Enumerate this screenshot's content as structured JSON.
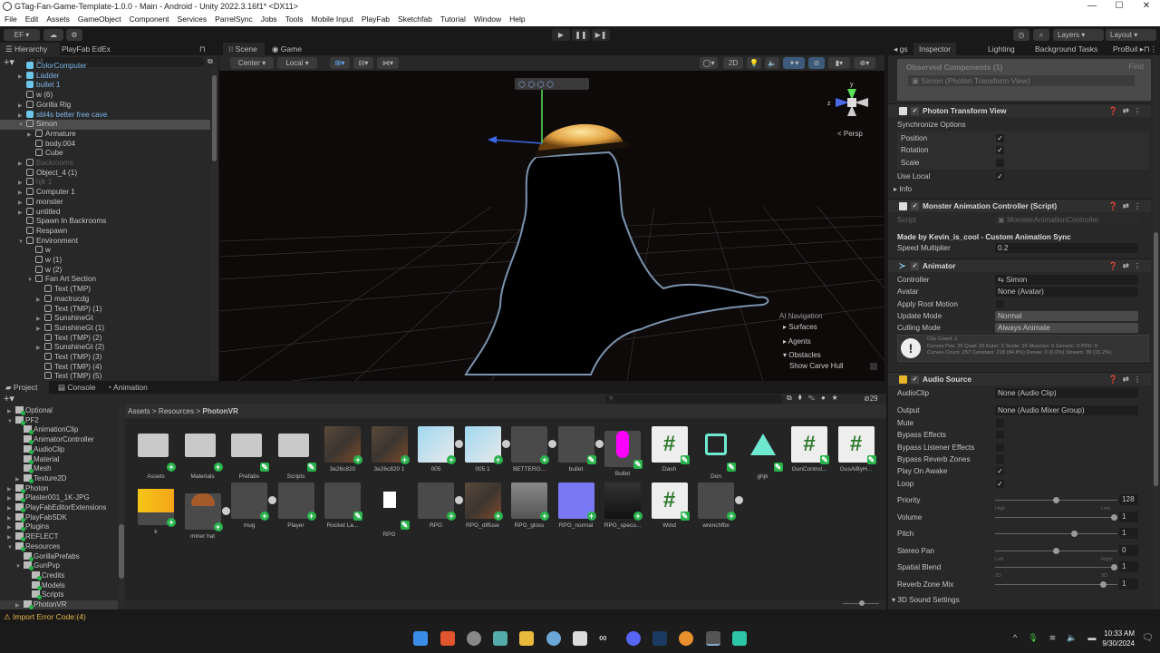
{
  "window": {
    "title": "GTag-Fan-Game-Template-1.0.0 - Main - Android - Unity 2022.3.16f1* <DX11>",
    "min": "—",
    "max": "☐",
    "close": "✕"
  },
  "menu": [
    "File",
    "Edit",
    "Assets",
    "GameObject",
    "Component",
    "Services",
    "ParrelSync",
    "Jobs",
    "Tools",
    "Mobile Input",
    "PlayFab",
    "Sketchfab",
    "Tutorial",
    "Window",
    "Help"
  ],
  "toolbar": {
    "account": "EF ▾",
    "layers": "Layers",
    "layout": "Layout"
  },
  "hierarchy": {
    "tabs": [
      "Hierarchy",
      "PlayFab EdEx"
    ],
    "search_placeholder": "All",
    "items": [
      {
        "label": "ColorComputer",
        "depth": 1,
        "arrow": "",
        "prefab": true,
        "dim": false
      },
      {
        "label": "Ladder",
        "depth": 1,
        "arrow": "▶",
        "prefab": true,
        "dim": false
      },
      {
        "label": "bullet 1",
        "depth": 1,
        "arrow": "",
        "prefab": true,
        "dim": false
      },
      {
        "label": "w (6)",
        "depth": 1,
        "arrow": "",
        "prefab": false,
        "dim": false
      },
      {
        "label": "Gorilla Rig",
        "depth": 1,
        "arrow": "▶",
        "prefab": false,
        "dim": false
      },
      {
        "label": "sbl4s better free cave",
        "depth": 1,
        "arrow": "▶",
        "prefab": true,
        "dim": false
      },
      {
        "label": "Simon",
        "depth": 1,
        "arrow": "▼",
        "prefab": false,
        "dim": false,
        "selected": true
      },
      {
        "label": "Armature",
        "depth": 2,
        "arrow": "▶",
        "prefab": false,
        "dim": false
      },
      {
        "label": "body.004",
        "depth": 2,
        "arrow": "",
        "prefab": false,
        "dim": false
      },
      {
        "label": "Cube",
        "depth": 2,
        "arrow": "",
        "prefab": false,
        "dim": false
      },
      {
        "label": "Backrooms",
        "depth": 1,
        "arrow": "▶",
        "prefab": false,
        "dim": true
      },
      {
        "label": "Object_4 (1)",
        "depth": 1,
        "arrow": "",
        "prefab": false,
        "dim": false
      },
      {
        "label": "hjk 1",
        "depth": 1,
        "arrow": "▶",
        "prefab": false,
        "dim": true
      },
      {
        "label": "Computer 1",
        "depth": 1,
        "arrow": "▶",
        "prefab": false,
        "dim": false
      },
      {
        "label": "monster",
        "depth": 1,
        "arrow": "▶",
        "prefab": false,
        "dim": false
      },
      {
        "label": "untitled",
        "depth": 1,
        "arrow": "▶",
        "prefab": false,
        "dim": false
      },
      {
        "label": "Spawn In Backrooms",
        "depth": 1,
        "arrow": "",
        "prefab": false,
        "dim": false
      },
      {
        "label": "Respawn",
        "depth": 1,
        "arrow": "",
        "prefab": false,
        "dim": false
      },
      {
        "label": "Environment",
        "depth": 1,
        "arrow": "▼",
        "prefab": false,
        "dim": false
      },
      {
        "label": "w",
        "depth": 2,
        "arrow": "",
        "prefab": false,
        "dim": false
      },
      {
        "label": "w (1)",
        "depth": 2,
        "arrow": "",
        "prefab": false,
        "dim": false
      },
      {
        "label": "w (2)",
        "depth": 2,
        "arrow": "",
        "prefab": false,
        "dim": false
      },
      {
        "label": "Fan Art Section",
        "depth": 2,
        "arrow": "▼",
        "prefab": false,
        "dim": false
      },
      {
        "label": "Text (TMP)",
        "depth": 3,
        "arrow": "",
        "prefab": false,
        "dim": false
      },
      {
        "label": "mactrucdg",
        "depth": 3,
        "arrow": "▶",
        "prefab": false,
        "dim": false
      },
      {
        "label": "Text (TMP) (1)",
        "depth": 3,
        "arrow": "",
        "prefab": false,
        "dim": false
      },
      {
        "label": "SunshineGt",
        "depth": 3,
        "arrow": "▶",
        "prefab": false,
        "dim": false
      },
      {
        "label": "SunshineGt (1)",
        "depth": 3,
        "arrow": "▶",
        "prefab": false,
        "dim": false
      },
      {
        "label": "Text (TMP) (2)",
        "depth": 3,
        "arrow": "",
        "prefab": false,
        "dim": false
      },
      {
        "label": "SunshineGt (2)",
        "depth": 3,
        "arrow": "▶",
        "prefab": false,
        "dim": false
      },
      {
        "label": "Text (TMP) (3)",
        "depth": 3,
        "arrow": "",
        "prefab": false,
        "dim": false
      },
      {
        "label": "Text (TMP) (4)",
        "depth": 3,
        "arrow": "",
        "prefab": false,
        "dim": false
      },
      {
        "label": "Text (TMP) (5)",
        "depth": 3,
        "arrow": "",
        "prefab": false,
        "dim": false
      }
    ]
  },
  "scene": {
    "tabs": [
      "Scene",
      "Game"
    ],
    "pivot": "Center ▾",
    "space": "Local ▾",
    "mode_2d": "2D",
    "persp": "< Persp",
    "gizmo_axes": {
      "y": "y",
      "z": "z"
    },
    "overlay": {
      "title": "AI Navigation",
      "items": [
        "▸ Surfaces",
        "▸ Agents",
        "▾ Obstacles"
      ],
      "option": "Show Carve Hull"
    }
  },
  "inspector": {
    "tabs": [
      "◂ gs",
      "Inspector",
      "Lighting",
      "Background Tasks",
      "ProBuil ▸"
    ],
    "observed": {
      "label": "Observed Components (1)",
      "find": "Find",
      "entry": "Simon (Photon Transform View)"
    },
    "photon": {
      "title": "Photon Transform View",
      "sync_label": "Synchronize Options",
      "options": [
        {
          "label": "Position",
          "checked": "✓"
        },
        {
          "label": "Rotation",
          "checked": "✓"
        },
        {
          "label": "Scale",
          "checked": ""
        }
      ],
      "use_local": "Use Local",
      "use_local_checked": "✓",
      "info": "▸ Info"
    },
    "monster": {
      "title": "Monster Animation Controller (Script)",
      "script_label": "Script",
      "script_value": "MonsterAnimationController",
      "credit": "Made by Kevin_is_cool - Custom Animation Sync",
      "speed_label": "Speed Multiplier",
      "speed_value": "0.2"
    },
    "animator": {
      "title": "Animator",
      "rows": [
        {
          "label": "Controller",
          "value": "⇆ Simon"
        },
        {
          "label": "Avatar",
          "value": "None (Avatar)"
        },
        {
          "label": "Apply Root Motion",
          "value": ""
        },
        {
          "label": "Update Mode",
          "value": "Normal"
        },
        {
          "label": "Culling Mode",
          "value": "Always Animate"
        }
      ],
      "info": [
        "Clip Count: 1",
        "Curves Pos: 26 Quat: 26 Euler: 0 Scale: 25 Muscles: 0 Generic: 0 PPtr: 0",
        "Curves Count: 257 Constant: 218 (84.8%) Dense: 0 (0.0%) Stream: 39 (15.2%)"
      ]
    },
    "audio": {
      "title": "Audio Source",
      "clip_label": "AudioClip",
      "clip_value": "None (Audio Clip)",
      "output_label": "Output",
      "output_value": "None (Audio Mixer Group)",
      "toggles": [
        {
          "label": "Mute",
          "checked": ""
        },
        {
          "label": "Bypass Effects",
          "checked": ""
        },
        {
          "label": "Bypass Listener Effects",
          "checked": ""
        },
        {
          "label": "Bypass Reverb Zones",
          "checked": ""
        },
        {
          "label": "Play On Awake",
          "checked": "✓"
        },
        {
          "label": "Loop",
          "checked": "✓"
        }
      ],
      "sliders": [
        {
          "label": "Priority",
          "value": "128",
          "fraction": 0.5,
          "min_label": "High",
          "max_label": "Low"
        },
        {
          "label": "Volume",
          "value": "1",
          "fraction": 1.0,
          "min_label": "",
          "max_label": ""
        },
        {
          "label": "Pitch",
          "value": "1",
          "fraction": 0.66,
          "min_label": "",
          "max_label": ""
        },
        {
          "label": "Stereo Pan",
          "value": "0",
          "fraction": 0.5,
          "min_label": "Left",
          "max_label": "Right"
        },
        {
          "label": "Spatial Blend",
          "value": "1",
          "fraction": 1.0,
          "min_label": "2D",
          "max_label": "3D"
        },
        {
          "label": "Reverb Zone Mix",
          "value": "1",
          "fraction": 0.91,
          "min_label": "",
          ",max_label": ""
        }
      ],
      "sound3d": "▾ 3D Sound Settings"
    }
  },
  "project": {
    "tabs": [
      "Project",
      "Console",
      "Animation"
    ],
    "breadcrumb": [
      "Assets",
      "Resources",
      "PhotonVR"
    ],
    "hidden_count": "29",
    "tree": [
      {
        "label": "Optional",
        "depth": 1,
        "arrow": "▶"
      },
      {
        "label": "PF2",
        "depth": 1,
        "arrow": "▼"
      },
      {
        "label": "AnimationClip",
        "depth": 2,
        "arrow": ""
      },
      {
        "label": "AnimatorController",
        "depth": 2,
        "arrow": ""
      },
      {
        "label": "AudioClip",
        "depth": 2,
        "arrow": ""
      },
      {
        "label": "Material",
        "depth": 2,
        "arrow": ""
      },
      {
        "label": "Mesh",
        "depth": 2,
        "arrow": ""
      },
      {
        "label": "Texture2D",
        "depth": 2,
        "arrow": "▶"
      },
      {
        "label": "Photon",
        "depth": 1,
        "arrow": "▶"
      },
      {
        "label": "Plaster001_1K-JPG",
        "depth": 1,
        "arrow": "▶"
      },
      {
        "label": "PlayFabEditorExtensions",
        "depth": 1,
        "arrow": "▶"
      },
      {
        "label": "PlayFabSDK",
        "depth": 1,
        "arrow": "▶"
      },
      {
        "label": "Plugins",
        "depth": 1,
        "arrow": "▶"
      },
      {
        "label": "REFLECT",
        "depth": 1,
        "arrow": "▶"
      },
      {
        "label": "Resources",
        "depth": 1,
        "arrow": "▼"
      },
      {
        "label": "GorillaPrefabs",
        "depth": 2,
        "arrow": ""
      },
      {
        "label": "GunPvp",
        "depth": 2,
        "arrow": "▼"
      },
      {
        "label": "Credits",
        "depth": 3,
        "arrow": ""
      },
      {
        "label": "Models",
        "depth": 3,
        "arrow": ""
      },
      {
        "label": "Scripts",
        "depth": 3,
        "arrow": ""
      },
      {
        "label": "PhotonVR",
        "depth": 2,
        "arrow": "▶"
      }
    ],
    "assets": [
      {
        "label": "Assets",
        "kind": "folder",
        "badge": "add"
      },
      {
        "label": "Materials",
        "kind": "folder",
        "badge": "add"
      },
      {
        "label": "Prefabs",
        "kind": "folder",
        "badge": "edit"
      },
      {
        "label": "Scripts",
        "kind": "folder",
        "badge": "edit"
      },
      {
        "label": "3e26c820",
        "kind": "texture",
        "badge": "add"
      },
      {
        "label": "3e26c820 1",
        "kind": "texture",
        "badge": "add"
      },
      {
        "label": "005",
        "kind": "box",
        "badge": "add"
      },
      {
        "label": "005 1",
        "kind": "box",
        "badge": "add"
      },
      {
        "label": "BETTERG...",
        "kind": "model",
        "badge": "add"
      },
      {
        "label": "bullet",
        "kind": "model",
        "badge": "edit"
      },
      {
        "label": "Bullet",
        "kind": "magenta",
        "badge": "edit"
      },
      {
        "label": "Dash",
        "kind": "script",
        "badge": "edit"
      },
      {
        "label": "Don",
        "kind": "anim",
        "badge": "edit"
      },
      {
        "label": "ghjk",
        "kind": "tri",
        "badge": "edit"
      },
      {
        "label": "GunControl...",
        "kind": "script",
        "badge": "edit"
      },
      {
        "label": "GusAiByH...",
        "kind": "script",
        "badge": "edit"
      },
      {
        "label": "k",
        "kind": "audio",
        "badge": "add"
      },
      {
        "label": "miner hat",
        "kind": "hat",
        "badge": "add"
      },
      {
        "label": "mug",
        "kind": "model",
        "badge": "add"
      },
      {
        "label": "Player",
        "kind": "model",
        "badge": "add"
      },
      {
        "label": "Rocket La...",
        "kind": "model",
        "badge": "edit"
      },
      {
        "label": "RPG",
        "kind": "file",
        "badge": "edit"
      },
      {
        "label": "RPG",
        "kind": "model",
        "badge": "add"
      },
      {
        "label": "RPG_diffuse",
        "kind": "texture",
        "badge": "add"
      },
      {
        "label": "RPG_gloss",
        "kind": "gray",
        "badge": "add"
      },
      {
        "label": "RPG_normal",
        "kind": "normal",
        "badge": "add"
      },
      {
        "label": "RPG_specu...",
        "kind": "dark",
        "badge": "add"
      },
      {
        "label": "Wind",
        "kind": "script",
        "badge": "edit"
      },
      {
        "label": "wrenchfbx",
        "kind": "model",
        "badge": "add"
      }
    ]
  },
  "status": {
    "message": "Import Error Code:(4)"
  },
  "taskbar": {
    "time": "10:33 AM",
    "date": "9/30/2024"
  },
  "colors": {
    "accent": "#3a79bb",
    "selected": "#4d4d4d",
    "prefab": "#7cb6e8",
    "badge": "#2ab24d"
  }
}
